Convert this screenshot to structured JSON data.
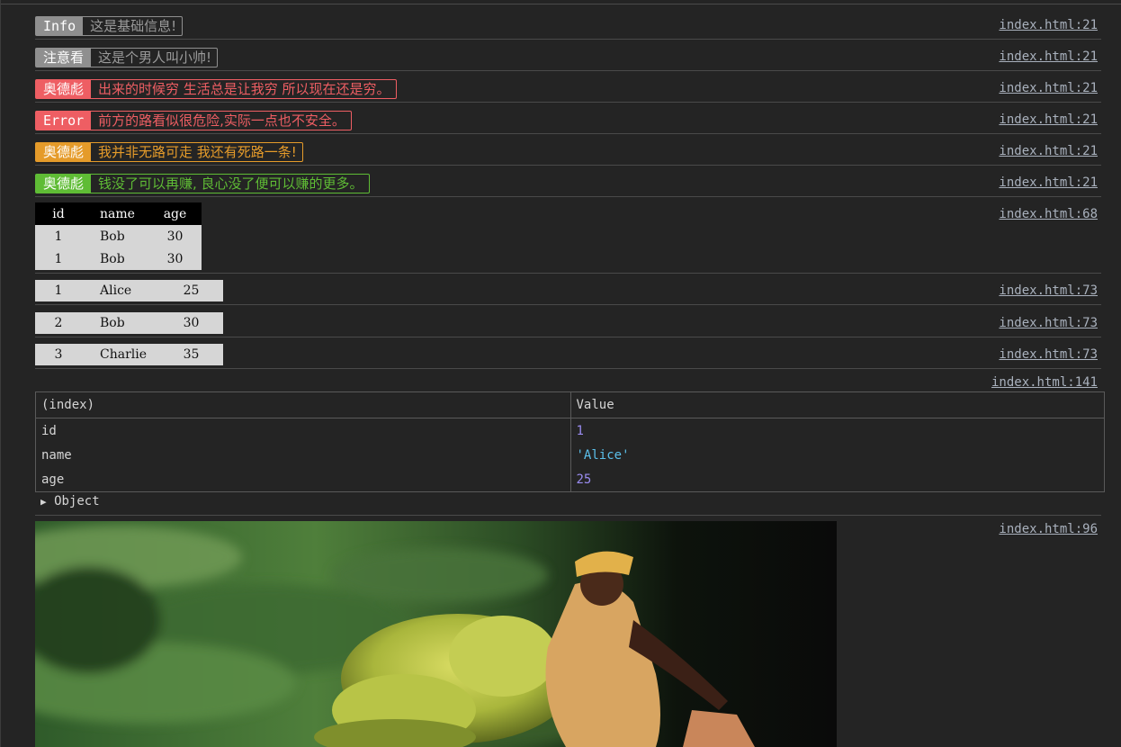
{
  "console_messages": [
    {
      "label": "Info",
      "text": "这是基础信息!",
      "source": "index.html:21"
    },
    {
      "label": "注意看",
      "text": "这是个男人叫小帅!",
      "source": "index.html:21"
    },
    {
      "label": "奥德彪",
      "text": "出来的时候穷 生活总是让我穷 所以现在还是穷。",
      "source": "index.html:21"
    },
    {
      "label": "Error",
      "text": "前方的路看似很危险,实际一点也不安全。",
      "source": "index.html:21"
    },
    {
      "label": "奥德彪",
      "text": "我并非无路可走 我还有死路一条!",
      "source": "index.html:21"
    },
    {
      "label": "奥德彪",
      "text": "钱没了可以再赚, 良心没了便可以赚的更多。",
      "source": "index.html:21"
    }
  ],
  "badge_colors": {
    "grey": "#8f8f8f",
    "red": "#ee5e63",
    "orange": "#e59b2a",
    "green": "#5fbc35"
  },
  "styled_table": {
    "source": "index.html:68",
    "headers": [
      "id",
      "name",
      "age"
    ],
    "rows": [
      [
        "1",
        "Bob",
        "30"
      ],
      [
        "1",
        "Bob",
        "30"
      ]
    ]
  },
  "row_tables": [
    {
      "cells": [
        "1",
        "Alice",
        "25"
      ],
      "source": "index.html:73"
    },
    {
      "cells": [
        "2",
        "Bob",
        "30"
      ],
      "source": "index.html:73"
    },
    {
      "cells": [
        "3",
        "Charlie",
        "35"
      ],
      "source": "index.html:73"
    }
  ],
  "console_table": {
    "source": "index.html:141",
    "headers": [
      "(index)",
      "Value"
    ],
    "rows": [
      {
        "key": "id",
        "value": "1"
      },
      {
        "key": "name",
        "value": "'Alice'"
      },
      {
        "key": "age",
        "value": "25"
      }
    ],
    "object_label": "Object"
  },
  "image_log": {
    "source": "index.html:96",
    "icon": "banana-bicycle-photo"
  }
}
